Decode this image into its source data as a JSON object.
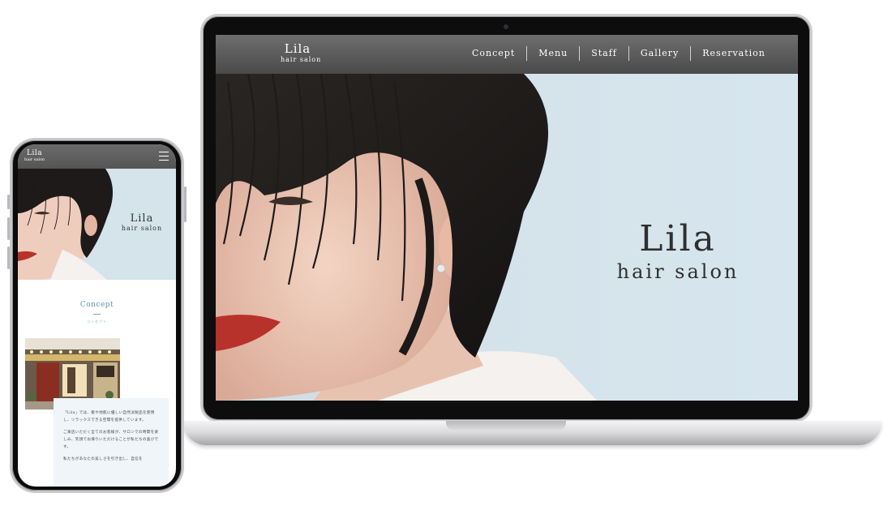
{
  "desktop": {
    "logo": {
      "name": "Lila",
      "sub": "hair salon"
    },
    "nav": [
      "Concept",
      "Menu",
      "Staff",
      "Gallery",
      "Reservation"
    ],
    "hero": {
      "name": "Lila",
      "sub": "hair salon"
    }
  },
  "mobile": {
    "logo": {
      "name": "Lila",
      "sub": "hair salon"
    },
    "menu_icon": "hamburger-icon",
    "hero": {
      "name": "Lila",
      "sub": "hair salon"
    },
    "concept": {
      "title": "Concept",
      "subtitle": "コンセプト",
      "paragraphs": [
        "「Lila」では、髪や地肌に優しい自然派製品を使用し、リラックスできる空間を提供しています。",
        "ご来店いただく全てのお客様が、サロンでの時間を楽しみ、笑顔でお帰りいただけることが私たちの喜びです。",
        "私たちがあなたの美しさを引き出し、自信を"
      ]
    }
  },
  "colors": {
    "header": "#555555",
    "hero_bg": "#d6e6ef",
    "accent": "#5f93b5",
    "card_bg": "#eff5f9"
  }
}
